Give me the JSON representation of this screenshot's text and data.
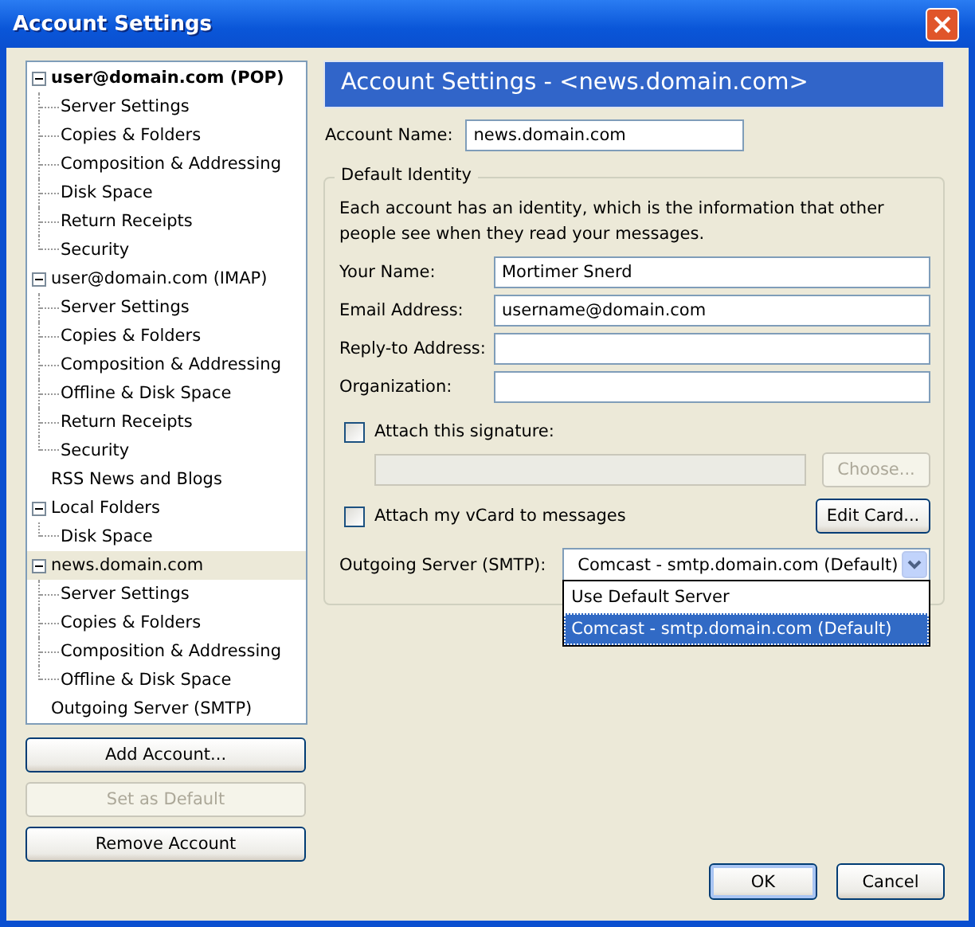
{
  "window": {
    "title": "Account Settings"
  },
  "tree": [
    {
      "label": "user@domain.com  (POP)",
      "default": true,
      "expanded": true,
      "selected": false,
      "children": [
        {
          "label": "Server Settings",
          "selected": false
        },
        {
          "label": "Copies & Folders",
          "selected": false
        },
        {
          "label": "Composition & Addressing",
          "selected": false
        },
        {
          "label": "Disk Space",
          "selected": false
        },
        {
          "label": "Return Receipts",
          "selected": false
        },
        {
          "label": "Security",
          "selected": false
        }
      ]
    },
    {
      "label": "user@domain.com  (IMAP)",
      "default": false,
      "expanded": true,
      "selected": false,
      "children": [
        {
          "label": "Server Settings",
          "selected": false
        },
        {
          "label": "Copies & Folders",
          "selected": false
        },
        {
          "label": "Composition & Addressing",
          "selected": false
        },
        {
          "label": "Offline & Disk Space",
          "selected": false
        },
        {
          "label": "Return Receipts",
          "selected": false
        },
        {
          "label": "Security",
          "selected": false
        }
      ]
    },
    {
      "label": "RSS News and Blogs",
      "default": false,
      "selected": false
    },
    {
      "label": "Local Folders",
      "default": false,
      "expanded": true,
      "selected": false,
      "children": [
        {
          "label": "Disk Space",
          "selected": false
        }
      ]
    },
    {
      "label": "news.domain.com",
      "default": false,
      "expanded": true,
      "selected": true,
      "children": [
        {
          "label": "Server Settings",
          "selected": false
        },
        {
          "label": "Copies & Folders",
          "selected": false
        },
        {
          "label": "Composition & Addressing",
          "selected": false
        },
        {
          "label": "Offline & Disk Space",
          "selected": false
        }
      ]
    },
    {
      "label": "Outgoing Server (SMTP)",
      "default": false,
      "selected": false
    }
  ],
  "account_buttons": [
    {
      "label": "Add Account...",
      "disabled": false
    },
    {
      "label": "Set as Default",
      "disabled": true
    },
    {
      "label": "Remove Account",
      "disabled": false
    }
  ],
  "panel": {
    "header": "Account Settings - <news.domain.com>",
    "account_name": {
      "label": "Account Name:",
      "value": "news.domain.com"
    },
    "identity": {
      "legend": "Default Identity",
      "description": "Each account has an identity, which is the information that other people see when they read your messages.",
      "fields": [
        {
          "label": "Your Name:",
          "value": "Mortimer Snerd"
        },
        {
          "label": "Email Address:",
          "value": "username@domain.com"
        },
        {
          "label": "Reply-to Address:"
        },
        {
          "label": "Organization:"
        }
      ],
      "signature": {
        "label": "Attach this signature:",
        "checked": false
      },
      "choose_button": {
        "label": "Choose...",
        "disabled": true
      },
      "vcard": {
        "label": "Attach my vCard to messages",
        "checked": false
      },
      "edit_card_button": {
        "label": "Edit Card...",
        "disabled": false
      },
      "smtp": {
        "label": "Outgoing Server (SMTP):",
        "value": "Comcast - smtp.domain.com (Default)",
        "expanded": true,
        "options": [
          {
            "label": "Use Default Server",
            "selected": false
          },
          {
            "label": "Comcast - smtp.domain.com (Default)",
            "selected": true
          }
        ]
      }
    }
  },
  "dialog_buttons": [
    {
      "label": "OK",
      "default": true
    },
    {
      "label": "Cancel",
      "default": false
    }
  ]
}
